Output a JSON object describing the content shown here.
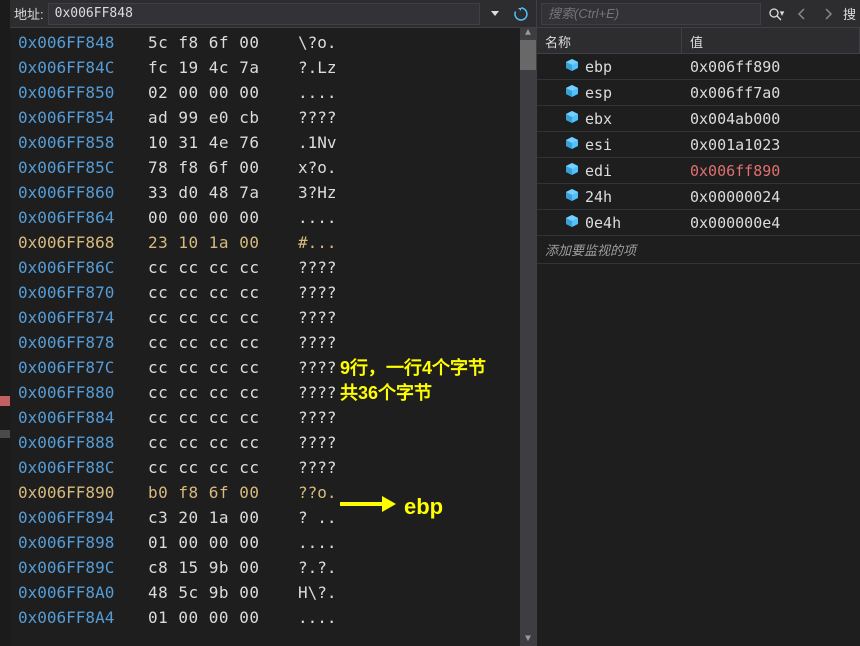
{
  "left": {
    "addr_label": "地址:",
    "addr_value": "0x006FF848",
    "rows": [
      {
        "addr": "0x006FF848",
        "bytes": "5c f8 6f 00",
        "ascii": "\\?o.",
        "hl": false
      },
      {
        "addr": "0x006FF84C",
        "bytes": "fc 19 4c 7a",
        "ascii": "?.Lz",
        "hl": false
      },
      {
        "addr": "0x006FF850",
        "bytes": "02 00 00 00",
        "ascii": "....",
        "hl": false
      },
      {
        "addr": "0x006FF854",
        "bytes": "ad 99 e0 cb",
        "ascii": "????",
        "hl": false
      },
      {
        "addr": "0x006FF858",
        "bytes": "10 31 4e 76",
        "ascii": ".1Nv",
        "hl": false
      },
      {
        "addr": "0x006FF85C",
        "bytes": "78 f8 6f 00",
        "ascii": "x?o.",
        "hl": false
      },
      {
        "addr": "0x006FF860",
        "bytes": "33 d0 48 7a",
        "ascii": "3?Hz",
        "hl": false
      },
      {
        "addr": "0x006FF864",
        "bytes": "00 00 00 00",
        "ascii": "....",
        "hl": false
      },
      {
        "addr": "0x006FF868",
        "bytes": "23 10 1a 00",
        "ascii": "#...",
        "hl": true
      },
      {
        "addr": "0x006FF86C",
        "bytes": "cc cc cc cc",
        "ascii": "????",
        "hl": false
      },
      {
        "addr": "0x006FF870",
        "bytes": "cc cc cc cc",
        "ascii": "????",
        "hl": false
      },
      {
        "addr": "0x006FF874",
        "bytes": "cc cc cc cc",
        "ascii": "????",
        "hl": false
      },
      {
        "addr": "0x006FF878",
        "bytes": "cc cc cc cc",
        "ascii": "????",
        "hl": false
      },
      {
        "addr": "0x006FF87C",
        "bytes": "cc cc cc cc",
        "ascii": "????",
        "hl": false
      },
      {
        "addr": "0x006FF880",
        "bytes": "cc cc cc cc",
        "ascii": "????",
        "hl": false
      },
      {
        "addr": "0x006FF884",
        "bytes": "cc cc cc cc",
        "ascii": "????",
        "hl": false
      },
      {
        "addr": "0x006FF888",
        "bytes": "cc cc cc cc",
        "ascii": "????",
        "hl": false
      },
      {
        "addr": "0x006FF88C",
        "bytes": "cc cc cc cc",
        "ascii": "????",
        "hl": false
      },
      {
        "addr": "0x006FF890",
        "bytes": "b0 f8 6f 00",
        "ascii": "??o.",
        "hl": true
      },
      {
        "addr": "0x006FF894",
        "bytes": "c3 20 1a 00",
        "ascii": "? ..",
        "hl": false
      },
      {
        "addr": "0x006FF898",
        "bytes": "01 00 00 00",
        "ascii": "....",
        "hl": false
      },
      {
        "addr": "0x006FF89C",
        "bytes": "c8 15 9b 00",
        "ascii": "?.?.",
        "hl": false
      },
      {
        "addr": "0x006FF8A0",
        "bytes": "48 5c 9b 00",
        "ascii": "H\\?.",
        "hl": false
      },
      {
        "addr": "0x006FF8A4",
        "bytes": "01 00 00 00",
        "ascii": "....",
        "hl": false
      }
    ],
    "annotation1_line1": "9行，一行4个字节",
    "annotation1_line2": "共36个字节",
    "annotation2": "ebp"
  },
  "right": {
    "search_placeholder": "搜索(Ctrl+E)",
    "header_name": "名称",
    "header_value": "值",
    "rows": [
      {
        "name": "ebp",
        "val": "0x006ff890",
        "changed": false
      },
      {
        "name": "esp",
        "val": "0x006ff7a0",
        "changed": false
      },
      {
        "name": "ebx",
        "val": "0x004ab000",
        "changed": false
      },
      {
        "name": "esi",
        "val": "0x001a1023",
        "changed": false
      },
      {
        "name": "edi",
        "val": "0x006ff890",
        "changed": true
      },
      {
        "name": "24h",
        "val": "0x00000024",
        "changed": false
      },
      {
        "name": "0e4h",
        "val": "0x000000e4",
        "changed": false
      }
    ],
    "add_label": "添加要监视的项",
    "edge_label": "搜"
  }
}
